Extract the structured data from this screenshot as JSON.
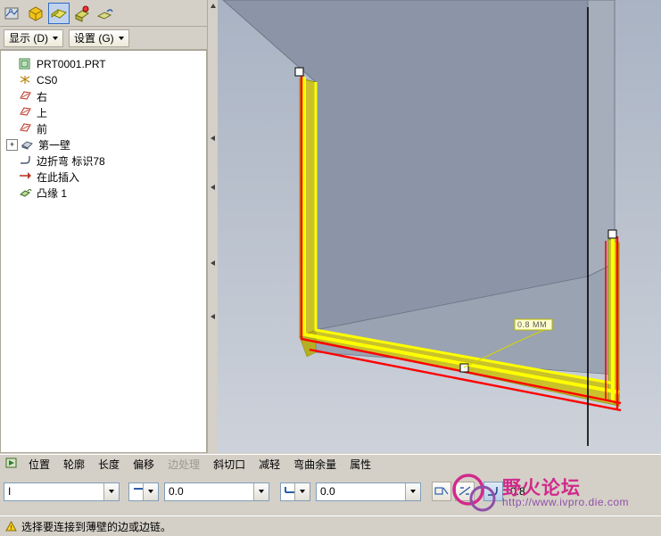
{
  "toolbar": {
    "buttons": [
      {
        "name": "sketch-tool-icon",
        "label": "草绘"
      },
      {
        "name": "extrude-tool-icon",
        "label": "拉伸"
      },
      {
        "name": "flat-wall-icon",
        "label": "平整壁"
      },
      {
        "name": "flange-wall-icon",
        "label": "凸缘壁"
      },
      {
        "name": "unbend-icon",
        "label": "展平"
      }
    ]
  },
  "display_bar": {
    "show_label": "显示 (D)",
    "settings_label": "设置 (G)"
  },
  "model_tree": {
    "root": "PRT0001.PRT",
    "items": [
      {
        "label": "CS0",
        "icon": "coordinate-system-icon",
        "indent": 1,
        "expander": null
      },
      {
        "label": "右",
        "icon": "datum-plane-icon",
        "indent": 1,
        "expander": null
      },
      {
        "label": "上",
        "icon": "datum-plane-icon",
        "indent": 1,
        "expander": null
      },
      {
        "label": "前",
        "icon": "datum-plane-icon",
        "indent": 1,
        "expander": null
      },
      {
        "label": "第一壁",
        "icon": "wall-feature-icon",
        "indent": 1,
        "expander": "+"
      },
      {
        "label": "边折弯 标识78",
        "icon": "bend-feature-icon",
        "indent": 1,
        "expander": null
      },
      {
        "label": "在此插入",
        "icon": "insert-here-icon",
        "indent": 1,
        "expander": null
      },
      {
        "label": "凸缘 1",
        "icon": "flange-feature-icon",
        "indent": 1,
        "expander": null
      }
    ]
  },
  "viewport": {
    "dimension_label": "0.8 MM"
  },
  "feature_tabs": [
    {
      "label": "位置",
      "disabled": false
    },
    {
      "label": "轮廓",
      "disabled": false
    },
    {
      "label": "长度",
      "disabled": false
    },
    {
      "label": "偏移",
      "disabled": false
    },
    {
      "label": "边处理",
      "disabled": true
    },
    {
      "label": "斜切口",
      "disabled": false
    },
    {
      "label": "减轻",
      "disabled": false
    },
    {
      "label": "弯曲余量",
      "disabled": false
    },
    {
      "label": "属性",
      "disabled": false
    }
  ],
  "dashboard": {
    "profile_value": "I",
    "shape_combo_value": "",
    "angle_value": "0.0",
    "length_combo_value": "",
    "offset_value": "0.0",
    "radius_value": "0.8",
    "buttons": [
      {
        "name": "flip-direction-button",
        "label": "反向"
      },
      {
        "name": "flip-geometry-button",
        "label": "切换几何"
      },
      {
        "name": "radius-toggle-button",
        "label": "半径"
      }
    ]
  },
  "status_bar": {
    "message": "选择要连接到薄壁的边或边链。"
  },
  "watermark": {
    "title": "野火论坛",
    "url": "http://www.ivpro.die.com"
  },
  "colors": {
    "accent_blue": "#316ac5",
    "highlight_red": "#ff0000",
    "highlight_yellow": "#ffff00",
    "face_gray": "#8c96a8",
    "watermark_pink": "#d12a8c"
  }
}
